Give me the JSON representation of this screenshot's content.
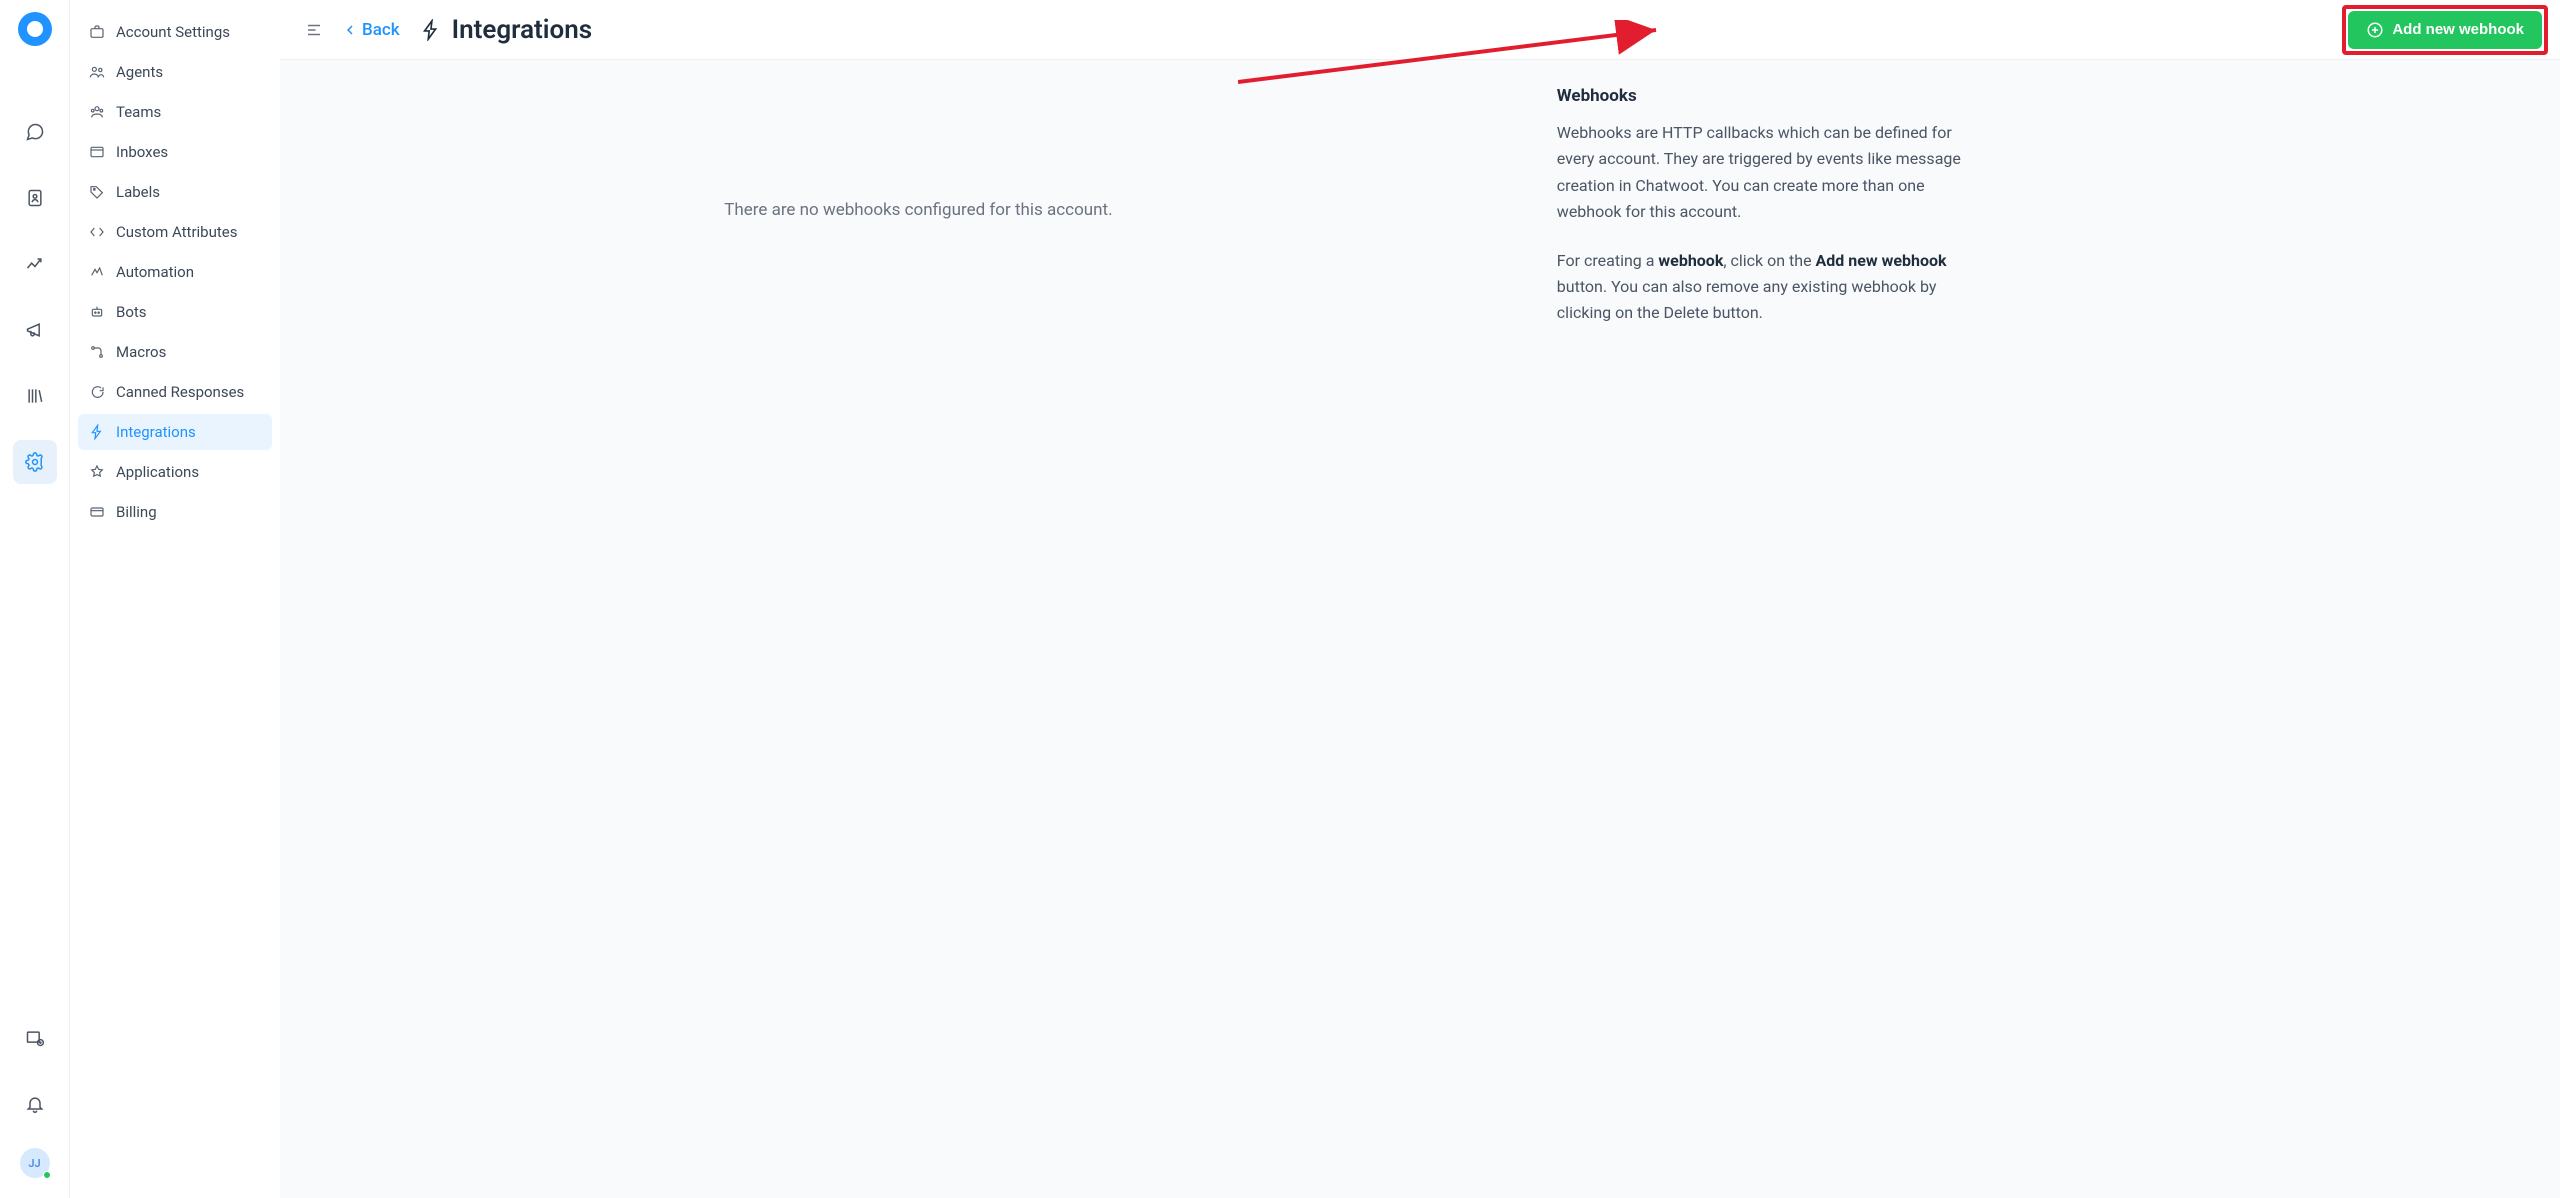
{
  "rail": {
    "avatar_initials": "JJ"
  },
  "sidebar": {
    "items": [
      {
        "label": "Account Settings"
      },
      {
        "label": "Agents"
      },
      {
        "label": "Teams"
      },
      {
        "label": "Inboxes"
      },
      {
        "label": "Labels"
      },
      {
        "label": "Custom Attributes"
      },
      {
        "label": "Automation"
      },
      {
        "label": "Bots"
      },
      {
        "label": "Macros"
      },
      {
        "label": "Canned Responses"
      },
      {
        "label": "Integrations"
      },
      {
        "label": "Applications"
      },
      {
        "label": "Billing"
      }
    ],
    "active_index": 10
  },
  "header": {
    "back_label": "Back",
    "title": "Integrations",
    "add_button": "Add new webhook"
  },
  "main": {
    "empty_state": "There are no webhooks configured for this account.",
    "info_title": "Webhooks",
    "info_p1": "Webhooks are HTTP callbacks which can be defined for every account. They are triggered by events like message creation in Chatwoot. You can create more than one webhook for this account.",
    "info_p2_a": "For creating a ",
    "info_p2_strong1": "webhook",
    "info_p2_b": ", click on the ",
    "info_p2_strong2": "Add new webhook",
    "info_p2_c": " button. You can also remove any existing webhook by clicking on the Delete button."
  }
}
